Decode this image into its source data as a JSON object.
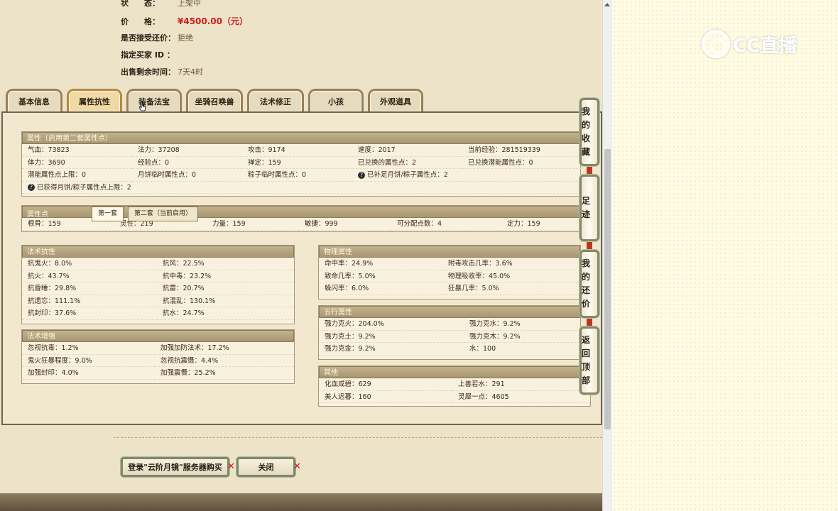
{
  "sale_info": {
    "status_key": "状　　态：",
    "status_val": "上架中",
    "price_key": "价　　格：",
    "price_val": "¥4500.00（元）",
    "counter_key": "是否接受还价：",
    "counter_val": "拒绝",
    "buyer_key": "指定买家 ID ：",
    "buyer_val": "",
    "time_key": "出售剩余时间：",
    "time_val": "7天4时"
  },
  "tabs": [
    "基本信息",
    "属性抗性",
    "装备法宝",
    "坐骑召唤兽",
    "法术修正",
    "小孩",
    "外观道具"
  ],
  "attributes": {
    "title": "属性（启用第二套属性点）",
    "rows": [
      [
        "气血：73823",
        "法力：37208",
        "攻击：9174",
        "速度：2017",
        "当前经验：281519339"
      ],
      [
        "体力：3690",
        "经验点：0",
        "禅定：159",
        "已兑换的属性点：2",
        "已兑换潜能属性点：0"
      ],
      [
        "潜能属性点上限：0",
        "月饼临时属性点：0",
        "粽子临时属性点：0",
        "已补足月饼/粽子属性点：2",
        ""
      ]
    ],
    "note": "已获得月饼/粽子属性点上限：2"
  },
  "points": {
    "title": "属性点",
    "set1": "第一套",
    "set2": "第二套（当前启用）",
    "values": [
      "根骨：159",
      "灵性：219",
      "力量：159",
      "敏捷：999",
      "可分配点数：4",
      "定力：159"
    ]
  },
  "magic_resist": {
    "title": "法术抗性",
    "items": [
      "抗鬼火：8.0%",
      "抗风：22.5%",
      "抗火：43.7%",
      "抗中毒：23.2%",
      "抗昏睡：29.8%",
      "抗雷：20.7%",
      "抗遗忘：111.1%",
      "抗混乱：130.1%",
      "抗封印：37.6%",
      "抗水：24.7%"
    ]
  },
  "magic_boost": {
    "title": "法术增强",
    "items": [
      "忽视抗毒：1.2%",
      "加强加防法术：17.2%",
      "鬼火狂暴程度：9.0%",
      "忽视抗震慑：4.4%",
      "加强封印：4.0%",
      "加强震慑：25.2%"
    ]
  },
  "physical": {
    "title": "物理属性",
    "items": [
      "命中率：24.9%",
      "附毒攻击几率：3.6%",
      "致命几率：5.0%",
      "物理吸收率：45.0%",
      "躲闪率：6.0%",
      "狂暴几率：5.0%"
    ]
  },
  "elements": {
    "title": "五行属性",
    "items": [
      "强力克火：204.0%",
      "强力克水：9.2%",
      "强力克土：9.2%",
      "强力克木：9.2%",
      "强力克金：9.2%",
      "水：100"
    ]
  },
  "other": {
    "title": "其他",
    "items": [
      "化血成碧：629",
      "上善若水：291",
      "美人迟暮：160",
      "灵犀一点：4605"
    ]
  },
  "side_nav": [
    "我的收藏",
    "足迹",
    "我的还价",
    "返回顶部"
  ],
  "buttons": {
    "login": "登录\"云阶月镜\"服务器购买",
    "close": "关闭"
  },
  "watermark": "CC直播"
}
